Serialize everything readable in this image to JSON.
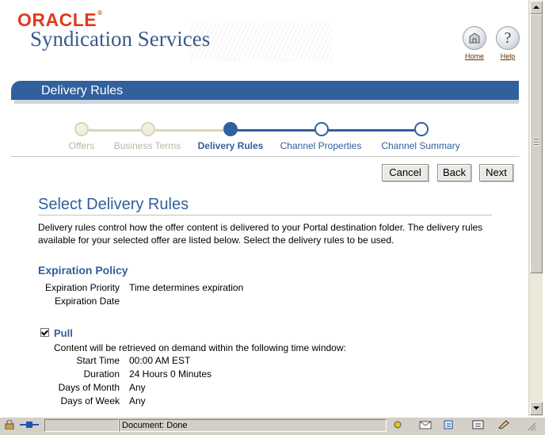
{
  "brand": {
    "oracle": "ORACLE",
    "trademark": "®",
    "product": "Syndication Services"
  },
  "global_buttons": {
    "home": "Home",
    "help": "Help"
  },
  "page_title": "Delivery Rules",
  "train": {
    "steps": [
      {
        "label": "Offers",
        "state": "visited"
      },
      {
        "label": "Business Terms",
        "state": "visited"
      },
      {
        "label": "Delivery Rules",
        "state": "current"
      },
      {
        "label": "Channel Properties",
        "state": "future"
      },
      {
        "label": "Channel Summary",
        "state": "future"
      }
    ]
  },
  "actions": {
    "cancel": "Cancel",
    "back": "Back",
    "next": "Next"
  },
  "content": {
    "heading": "Select Delivery Rules",
    "intro": "Delivery rules control how the offer content is delivered to your Portal destination folder. The delivery rules available for your selected offer are listed below. Select the delivery rules to be used.",
    "expiration": {
      "heading": "Expiration Policy",
      "priority_label": "Expiration Priority",
      "priority_value": "Time determines expiration",
      "date_label": "Expiration Date",
      "date_value": ""
    },
    "pull": {
      "checked": true,
      "label": "Pull",
      "description": "Content will be retrieved on demand within the following time window:",
      "start_time_label": "Start Time",
      "start_time_value": "00:00 AM EST",
      "duration_label": "Duration",
      "duration_value": "24 Hours 0 Minutes",
      "days_month_label": "Days of Month",
      "days_month_value": "Any",
      "days_week_label": "Days of Week",
      "days_week_value": "Any"
    }
  },
  "status_bar": {
    "text": "Document: Done"
  },
  "colors": {
    "oracle_red": "#e03a1e",
    "brand_blue": "#31609c",
    "title_bar": "#31609c"
  }
}
